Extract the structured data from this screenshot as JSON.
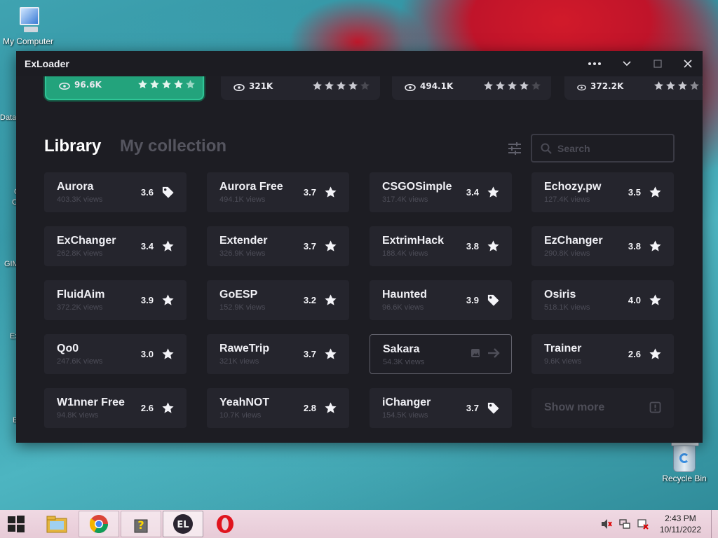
{
  "desktop": {
    "my_computer_label": "My Computer",
    "recycle_bin_label": "Recycle Bin",
    "partial_labels": [
      "Data",
      "C",
      "C",
      "GIM",
      "Ex",
      "E"
    ]
  },
  "window": {
    "title": "ExLoader",
    "controls": [
      "more-options",
      "collapse",
      "maximize",
      "close"
    ]
  },
  "carousel": [
    {
      "views": "96.6K",
      "stars": 4.5,
      "active": true
    },
    {
      "views": "321K",
      "stars": 4,
      "active": false
    },
    {
      "views": "494.1K",
      "stars": 4,
      "active": false
    },
    {
      "views": "372.2K",
      "stars": 3.5,
      "active": false
    }
  ],
  "tabs": {
    "library": "Library",
    "collection": "My collection"
  },
  "search": {
    "placeholder": "Search"
  },
  "library": [
    {
      "name": "Aurora",
      "views": "403.3K views",
      "rating": "3.6",
      "icon": "tag-icon"
    },
    {
      "name": "Aurora Free",
      "views": "494.1K views",
      "rating": "3.7",
      "icon": "star-icon"
    },
    {
      "name": "CSGOSimple",
      "views": "317.4K views",
      "rating": "3.4",
      "icon": "star-icon"
    },
    {
      "name": "Echozy.pw",
      "views": "127.4K views",
      "rating": "3.5",
      "icon": "star-icon"
    },
    {
      "name": "ExChanger",
      "views": "262.8K views",
      "rating": "3.4",
      "icon": "star-icon"
    },
    {
      "name": "Extender",
      "views": "326.9K views",
      "rating": "3.7",
      "icon": "star-icon"
    },
    {
      "name": "ExtrimHack",
      "views": "188.4K views",
      "rating": "3.8",
      "icon": "star-icon"
    },
    {
      "name": "EzChanger",
      "views": "290.8K views",
      "rating": "3.8",
      "icon": "star-icon"
    },
    {
      "name": "FluidAim",
      "views": "372.2K views",
      "rating": "3.9",
      "icon": "star-icon"
    },
    {
      "name": "GoESP",
      "views": "152.9K views",
      "rating": "3.2",
      "icon": "star-icon"
    },
    {
      "name": "Haunted",
      "views": "96.6K views",
      "rating": "3.9",
      "icon": "tag-icon"
    },
    {
      "name": "Osiris",
      "views": "518.1K views",
      "rating": "4.0",
      "icon": "star-icon"
    },
    {
      "name": "Qo0",
      "views": "247.6K views",
      "rating": "3.0",
      "icon": "star-icon"
    },
    {
      "name": "RaweTrip",
      "views": "321K views",
      "rating": "3.7",
      "icon": "star-icon"
    },
    {
      "name": "Sakara",
      "views": "54.3K views",
      "rating": "",
      "icon": "hover"
    },
    {
      "name": "Trainer",
      "views": "9.6K views",
      "rating": "2.6",
      "icon": "star-icon"
    },
    {
      "name": "W1nner Free",
      "views": "94.8K views",
      "rating": "2.6",
      "icon": "star-icon"
    },
    {
      "name": "YeahNOT",
      "views": "10.7K views",
      "rating": "2.8",
      "icon": "star-icon"
    },
    {
      "name": "iChanger",
      "views": "154.5K views",
      "rating": "3.7",
      "icon": "tag-icon"
    }
  ],
  "show_more": {
    "label": "Show more"
  },
  "taskbar": {
    "apps": [
      "file-explorer-icon",
      "chrome-icon",
      "help-icon",
      "exloader-icon",
      "opera-icon"
    ],
    "clock_time": "2:43 PM",
    "clock_date": "10/11/2022"
  },
  "colors": {
    "window_bg": "#1d1d23",
    "card_bg": "#25252d",
    "accent_green": "#23a37c",
    "text_dim": "#4d4d58"
  }
}
